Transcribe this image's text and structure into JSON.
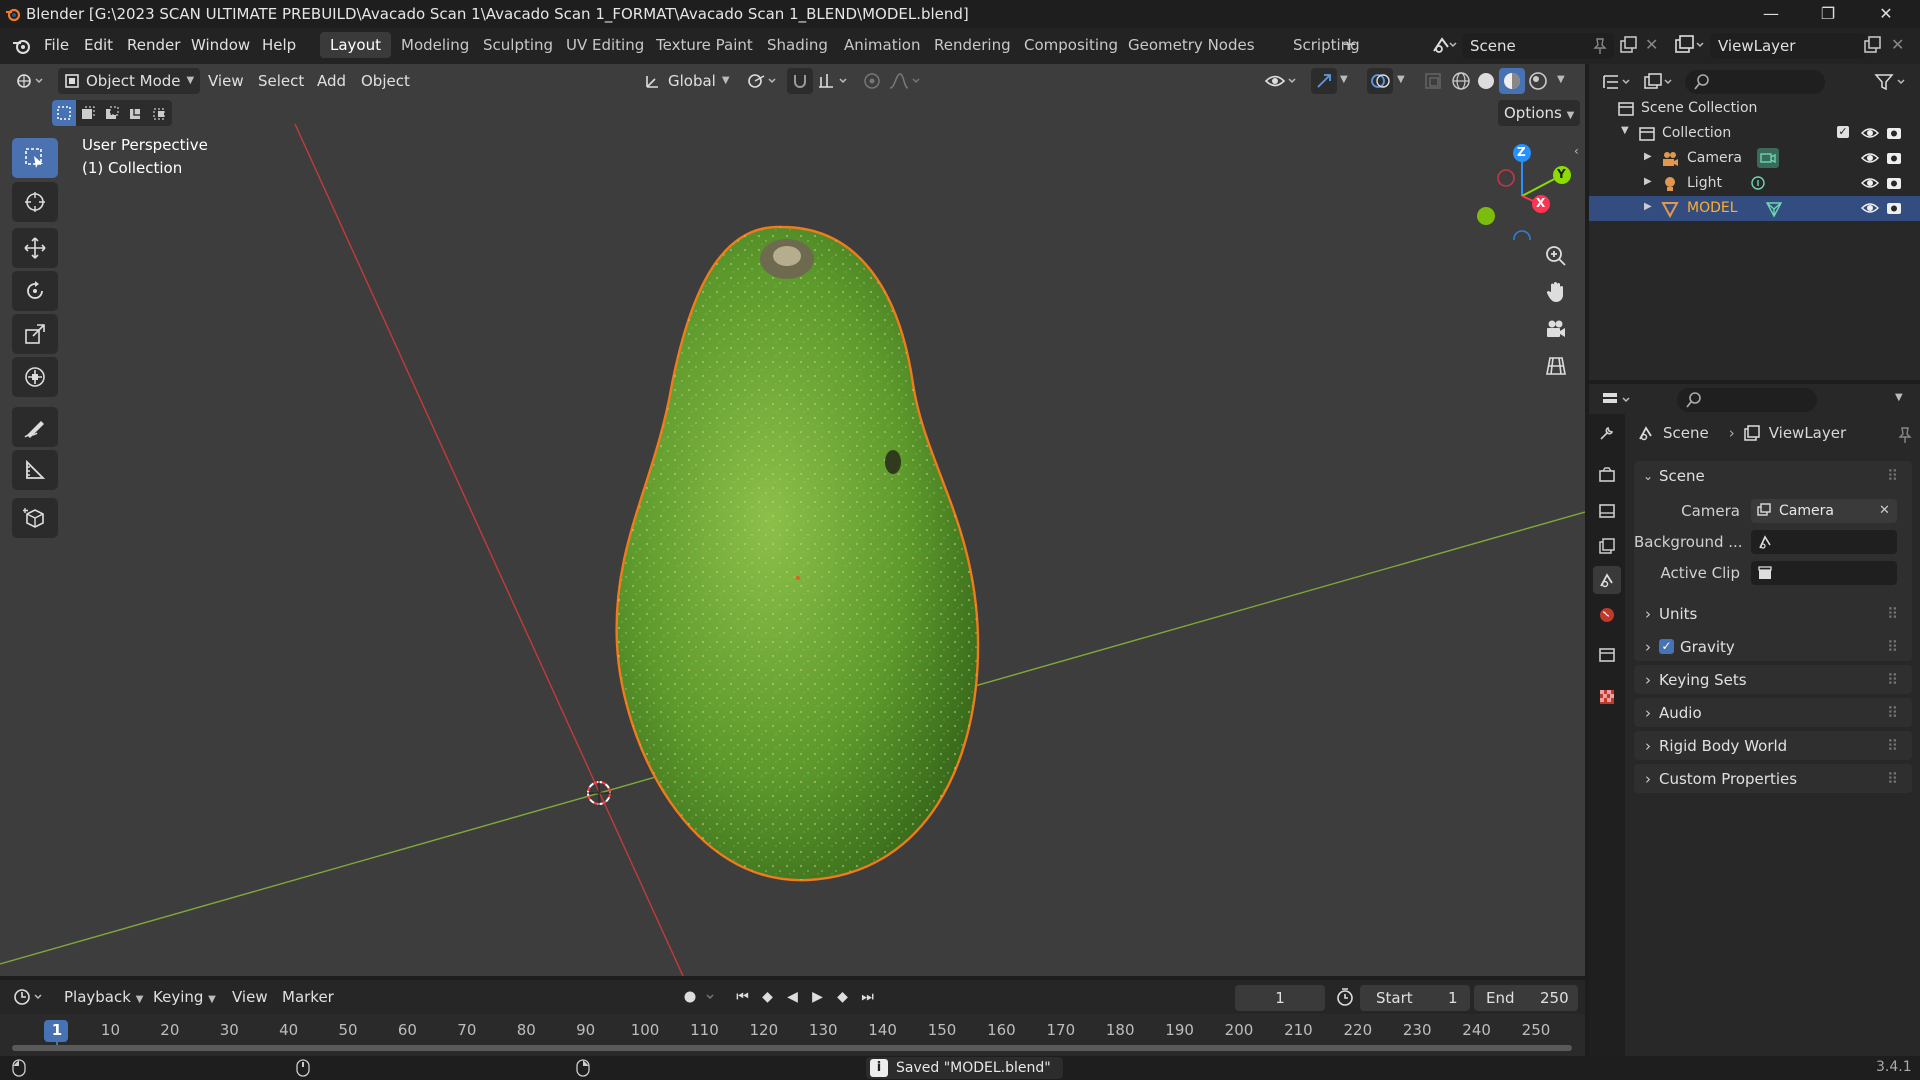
{
  "window": {
    "title": "Blender [G:\\2023 SCAN ULTIMATE PREBUILD\\Avacado Scan 1\\Avacado Scan 1_FORMAT\\Avacado Scan 1_BLEND\\MODEL.blend]",
    "controls": {
      "minimize": "—",
      "restore": "❐",
      "close": "✕"
    }
  },
  "menu": {
    "file": "File",
    "edit": "Edit",
    "render": "Render",
    "window": "Window",
    "help": "Help"
  },
  "workspaces": [
    "Layout",
    "Modeling",
    "Sculpting",
    "UV Editing",
    "Texture Paint",
    "Shading",
    "Animation",
    "Rendering",
    "Compositing",
    "Geometry Nodes",
    "Scripting"
  ],
  "workspace_add": "+",
  "scene_selector": {
    "value": "Scene"
  },
  "viewlayer_selector": {
    "value": "ViewLayer"
  },
  "viewport_header": {
    "mode": "Object Mode",
    "view": "View",
    "select": "Select",
    "add": "Add",
    "object": "Object",
    "orientation": "Global",
    "options": "Options"
  },
  "viewport_overlay": {
    "perspective": "User Perspective",
    "collection": "(1) Collection"
  },
  "gizmo": {
    "z": "Z",
    "y": "Y",
    "x": "X"
  },
  "outliner": {
    "scene_collection": "Scene Collection",
    "collection": "Collection",
    "items": [
      {
        "name": "Camera",
        "selected": false
      },
      {
        "name": "Light",
        "selected": false
      },
      {
        "name": "MODEL",
        "selected": true
      }
    ]
  },
  "properties": {
    "breadcrumb": {
      "scene": "Scene",
      "separator": "›",
      "viewlayer": "ViewLayer"
    },
    "scene_panel": {
      "title": "Scene",
      "camera_label": "Camera",
      "camera_value": "Camera",
      "background_label": "Background ...",
      "active_clip_label": "Active Clip"
    },
    "panels": [
      {
        "title": "Units",
        "checkbox": false
      },
      {
        "title": "Gravity",
        "checkbox": true
      },
      {
        "title": "Keying Sets",
        "checkbox": false
      },
      {
        "title": "Audio",
        "checkbox": false
      },
      {
        "title": "Rigid Body World",
        "checkbox": false
      },
      {
        "title": "Custom Properties",
        "checkbox": false
      }
    ]
  },
  "timeline": {
    "playback": "Playback",
    "keying": "Keying",
    "view": "View",
    "marker": "Marker",
    "current_frame": "1",
    "start_label": "Start",
    "start_value": "1",
    "end_label": "End",
    "end_value": "250",
    "ruler": [
      "1",
      "10",
      "20",
      "30",
      "40",
      "50",
      "60",
      "70",
      "80",
      "90",
      "100",
      "110",
      "120",
      "130",
      "140",
      "150",
      "160",
      "170",
      "180",
      "190",
      "200",
      "210",
      "220",
      "230",
      "240",
      "250"
    ]
  },
  "status": {
    "message": "Saved \"MODEL.blend\"",
    "version": "3.4.1"
  },
  "colors": {
    "accent": "#4772b3",
    "selected_object": "#ffaf29",
    "x_axis": "#ff3352",
    "y_axis": "#8bdc00",
    "z_axis": "#2890ff",
    "avocado": "#5d9a2c"
  }
}
